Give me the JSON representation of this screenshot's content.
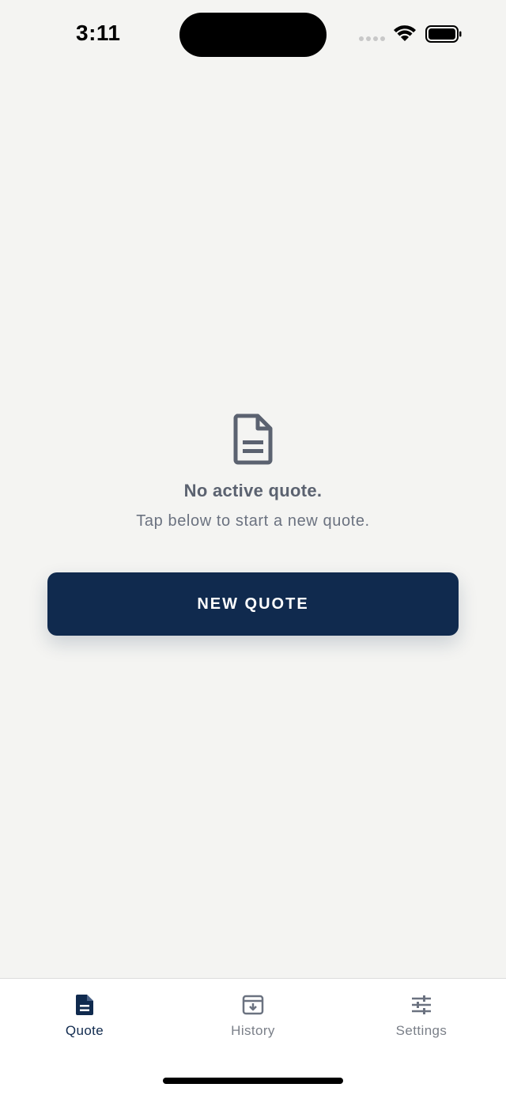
{
  "status_bar": {
    "time": "3:11"
  },
  "empty_state": {
    "icon": "document-icon",
    "title": "No active quote.",
    "subtitle": "Tap below to start a new quote."
  },
  "primary_action": {
    "label": "NEW QUOTE"
  },
  "tab_bar": {
    "tabs": [
      {
        "label": "Quote",
        "icon": "document-filled-icon",
        "active": true
      },
      {
        "label": "History",
        "icon": "archive-icon",
        "active": false
      },
      {
        "label": "Settings",
        "icon": "sliders-icon",
        "active": false
      }
    ]
  },
  "colors": {
    "background": "#f4f4f2",
    "primary": "#102a4e",
    "muted_text": "#6b7280",
    "inactive_tab": "#7a7f88"
  }
}
